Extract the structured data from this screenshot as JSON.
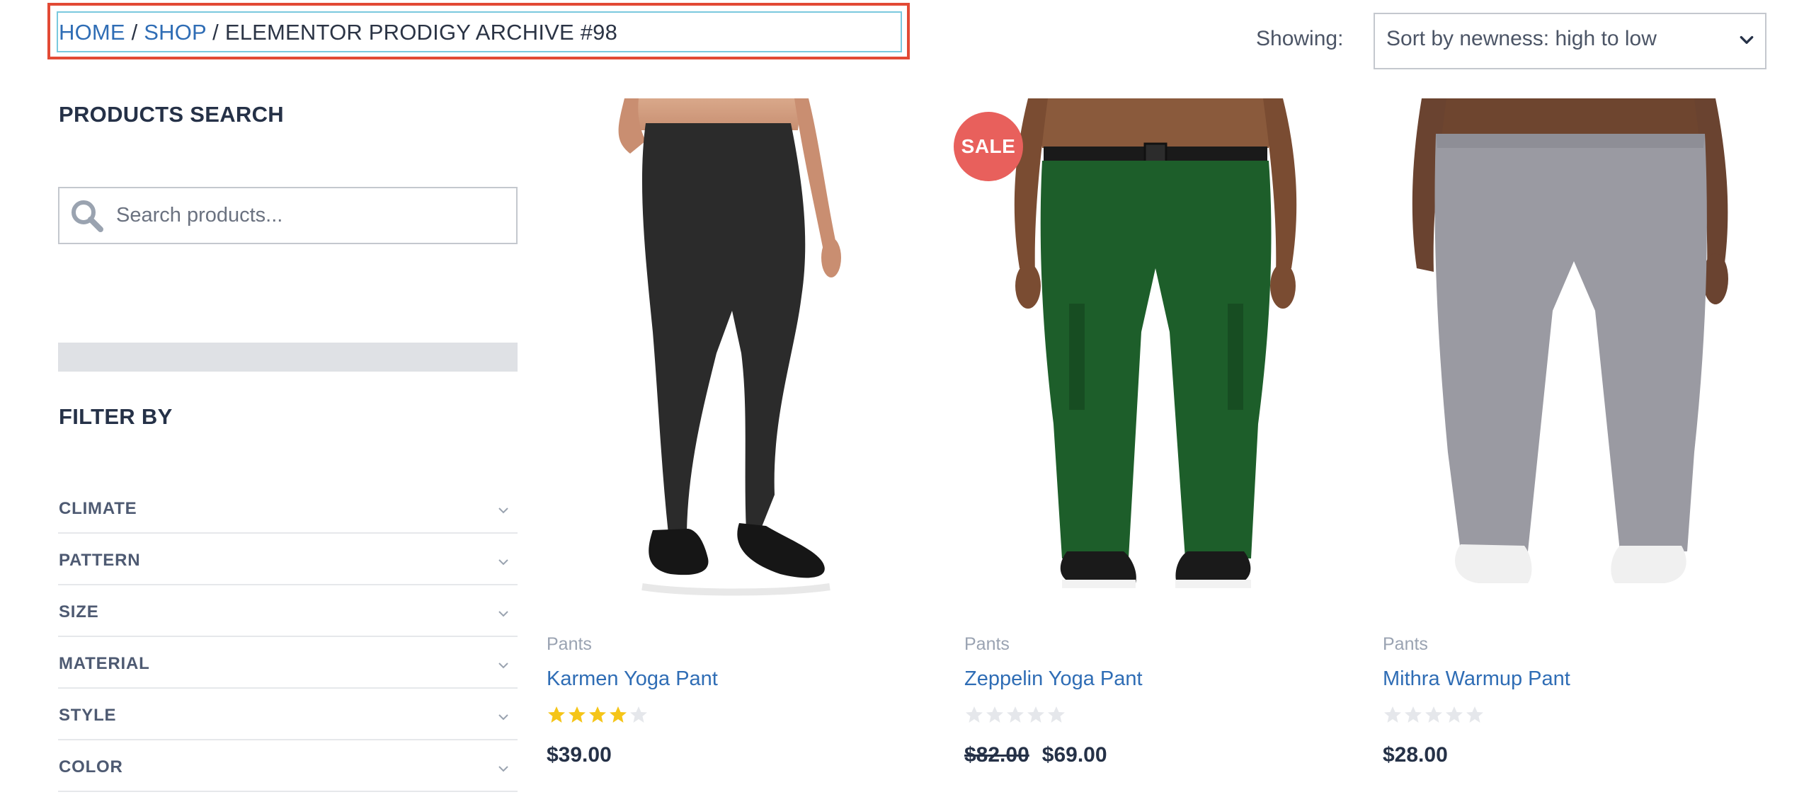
{
  "breadcrumb": {
    "home": "HOME",
    "sep1": " / ",
    "shop": "SHOP",
    "sep2": " / ",
    "current": "ELEMENTOR PRODIGY ARCHIVE #98"
  },
  "sorting": {
    "label": "Showing:",
    "selected": "Sort by newness: high to low"
  },
  "sidebar": {
    "search_title": "PRODUCTS SEARCH",
    "search_placeholder": "Search products...",
    "filter_title": "FILTER BY",
    "filters": [
      {
        "label": "CLIMATE"
      },
      {
        "label": "PATTERN"
      },
      {
        "label": "SIZE"
      },
      {
        "label": "MATERIAL"
      },
      {
        "label": "STYLE"
      },
      {
        "label": "COLOR"
      }
    ]
  },
  "products": [
    {
      "category": "Pants",
      "name": "Karmen Yoga Pant",
      "rating": 4,
      "price": "$39.00",
      "old_price": "",
      "image": "black-leggings"
    },
    {
      "category": "Pants",
      "name": "Zeppelin Yoga Pant",
      "rating": 0,
      "price": "$69.00",
      "old_price": "$82.00",
      "image": "green-cargo-pants",
      "badge": "SALE"
    },
    {
      "category": "Pants",
      "name": "Mithra Warmup Pant",
      "rating": 0,
      "price": "$28.00",
      "old_price": "",
      "image": "gray-warmup-pants"
    }
  ],
  "colors": {
    "link": "#2f6db5",
    "heading": "#253147",
    "sale_badge": "#e8605c",
    "star_filled": "#f5c518",
    "star_empty": "#e5e7eb",
    "highlight_frame": "#e24a35"
  }
}
